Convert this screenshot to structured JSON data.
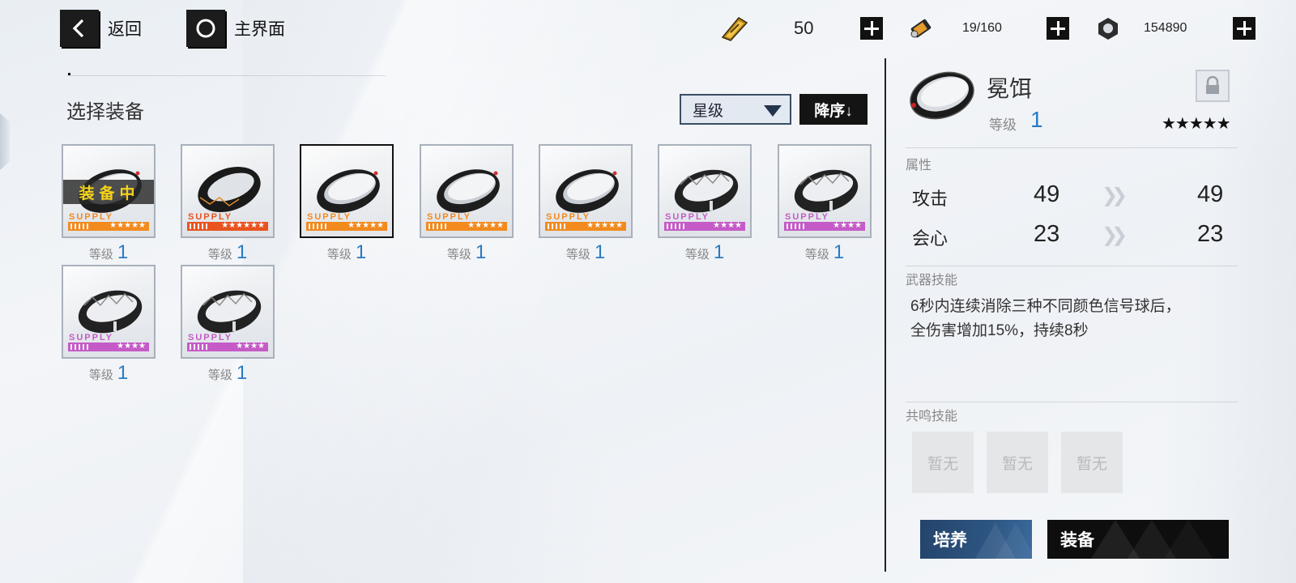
{
  "topbar": {
    "back_label": "返回",
    "home_label": "主界面",
    "resources": [
      {
        "icon": "gold-ticket-icon",
        "value": "50"
      },
      {
        "icon": "battery-canister-icon",
        "value": "19/160"
      },
      {
        "icon": "hex-nut-icon",
        "value": "154890"
      }
    ]
  },
  "list": {
    "title": "选择装备",
    "sort_by": "星级",
    "sort_order": "降序↓",
    "level_label": "等级",
    "equipped_label": "装备中",
    "supply_text": "SUPPLY",
    "items": [
      {
        "level": "1",
        "rarity": "orange",
        "stars": "★★★★★",
        "equipped": true,
        "selected": false,
        "ring": "plain"
      },
      {
        "level": "1",
        "rarity": "red",
        "stars": "★★★★★★",
        "equipped": false,
        "selected": false,
        "ring": "braided"
      },
      {
        "level": "1",
        "rarity": "orange",
        "stars": "★★★★★",
        "equipped": false,
        "selected": true,
        "ring": "plain"
      },
      {
        "level": "1",
        "rarity": "orange",
        "stars": "★★★★★",
        "equipped": false,
        "selected": false,
        "ring": "plain"
      },
      {
        "level": "1",
        "rarity": "orange",
        "stars": "★★★★★",
        "equipped": false,
        "selected": false,
        "ring": "plain"
      },
      {
        "level": "1",
        "rarity": "purple",
        "stars": "★★★★",
        "equipped": false,
        "selected": false,
        "ring": "zigzag"
      },
      {
        "level": "1",
        "rarity": "purple",
        "stars": "★★★★",
        "equipped": false,
        "selected": false,
        "ring": "zigzag"
      },
      {
        "level": "1",
        "rarity": "purple",
        "stars": "★★★★",
        "equipped": false,
        "selected": false,
        "ring": "zigzag"
      },
      {
        "level": "1",
        "rarity": "purple",
        "stars": "★★★★",
        "equipped": false,
        "selected": false,
        "ring": "zigzag"
      }
    ]
  },
  "detail": {
    "name": "冕饵",
    "level_label": "等级",
    "level": "1",
    "stars": "★★★★★",
    "attributes_label": "属性",
    "stats": [
      {
        "name": "攻击",
        "current": "49",
        "next": "49"
      },
      {
        "name": "会心",
        "current": "23",
        "next": "23"
      }
    ],
    "weapon_skill_label": "武器技能",
    "weapon_skill_lines": [
      "6秒内连续消除三种不同颜色信号球后，",
      "全伤害增加15%，持续8秒"
    ],
    "resonance_label": "共鸣技能",
    "resonance_slots": [
      "暂无",
      "暂无",
      "暂无"
    ],
    "train_label": "培养",
    "equip_label": "装备"
  },
  "colors": {
    "orange": "#f28a1e",
    "red": "#e9531f",
    "purple": "#c55bc7",
    "level_blue": "#2b7bc0",
    "equipped_yellow": "#f4d21b"
  }
}
